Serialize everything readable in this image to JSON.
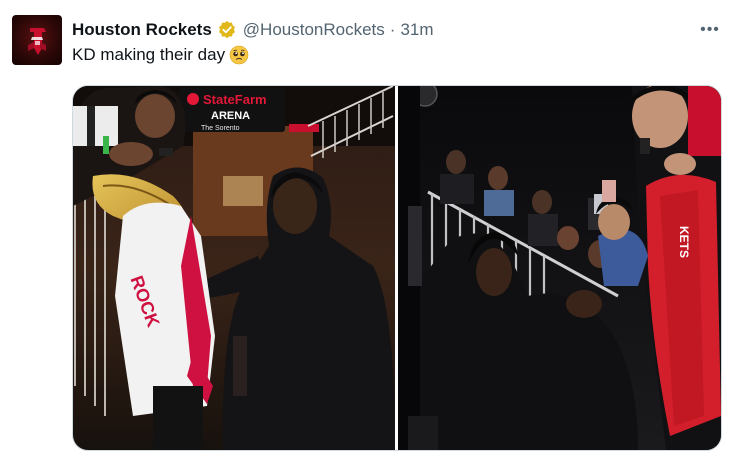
{
  "tweet": {
    "display_name": "Houston Rockets",
    "handle": "@HoustonRockets",
    "separator": "·",
    "time": "31m",
    "text": "KD making their day",
    "more_label": "•••",
    "icons": {
      "avatar": "rockets-logo-icon",
      "verified": "gold-verified-badge-icon",
      "more": "more-options-icon",
      "emoji": "pleading-face-emoji-icon"
    }
  },
  "media": {
    "photo_count": 2,
    "sign_brand": "StateFarm",
    "sign_sub": "ARENA",
    "sign_caption": "The Sorento"
  },
  "colors": {
    "text_primary": "#0f1419",
    "text_secondary": "#536471",
    "border": "#cfd9de",
    "verified_gold": "#e2b719",
    "rockets_red": "#ce1141"
  }
}
